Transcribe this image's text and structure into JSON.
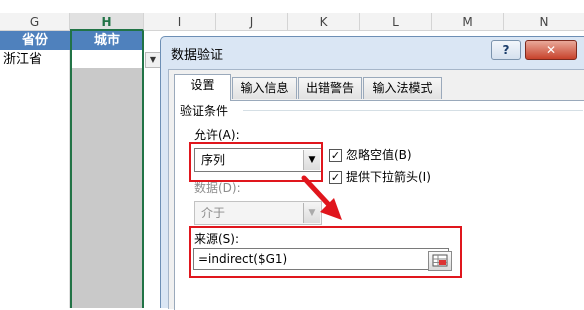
{
  "sheet": {
    "column_headers": [
      "G",
      "H",
      "I",
      "J",
      "K",
      "L",
      "M",
      "N"
    ],
    "selected_column": "H",
    "header_row": {
      "province": "省份",
      "city": "城市"
    },
    "row1": {
      "province": "浙江省"
    }
  },
  "dialog": {
    "title": "数据验证",
    "help_label": "?",
    "close_label": "✕",
    "tabs": [
      "设置",
      "输入信息",
      "出错警告",
      "输入法模式"
    ],
    "active_tab": "设置",
    "section_title": "验证条件",
    "allow_label": "允许(A):",
    "allow_value": "序列",
    "ignore_blank_label": "忽略空值(B)",
    "ignore_blank_checked": true,
    "dropdown_label": "提供下拉箭头(I)",
    "dropdown_checked": true,
    "data_label": "数据(D):",
    "data_value": "介于",
    "source_label": "来源(S):",
    "source_value": "=indirect($G1)"
  },
  "colors": {
    "accent": "#e0161d",
    "header_fill": "#4f81bd",
    "selected_col": "#217346"
  }
}
